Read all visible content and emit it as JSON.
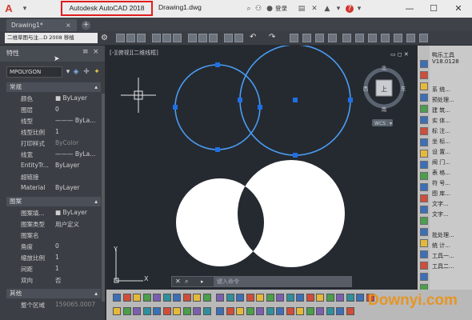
{
  "titlebar": {
    "app_logo": "A",
    "app_name": "Autodesk AutoCAD 2018",
    "document": "Drawing1.dwg",
    "login": "登录",
    "window_controls": [
      "—",
      "☐",
      "✕"
    ]
  },
  "tabs": {
    "active": "Drawing1*",
    "close_glyph": "×",
    "add_glyph": "+"
  },
  "toolbar": {
    "workspace": "二维草图与注...D 2008 移植"
  },
  "properties": {
    "title": "特性",
    "close_glyph": "×",
    "object_type": "MPOLYGON",
    "sections": [
      {
        "title": "常规",
        "rows": [
          {
            "label": "颜色",
            "value": "■ ByLayer"
          },
          {
            "label": "图层",
            "value": "0"
          },
          {
            "label": "线型",
            "value": "——— ByLa..."
          },
          {
            "label": "线型比例",
            "value": "1"
          },
          {
            "label": "打印样式",
            "value": "ByColor"
          },
          {
            "label": "线宽",
            "value": "——— ByLa..."
          },
          {
            "label": "EntityTr...",
            "value": "ByLayer"
          },
          {
            "label": "超链接",
            "value": ""
          },
          {
            "label": "Material",
            "value": "ByLayer"
          }
        ]
      },
      {
        "title": "图案",
        "rows": [
          {
            "label": "图案填...",
            "value": "■ ByLayer"
          },
          {
            "label": "图案类型",
            "value": "用户定义"
          },
          {
            "label": "图案名",
            "value": ""
          },
          {
            "label": "角度",
            "value": "0"
          },
          {
            "label": "缩放比例",
            "value": "1"
          },
          {
            "label": "间距",
            "value": "1"
          },
          {
            "label": "双向",
            "value": "否"
          }
        ]
      },
      {
        "title": "其他",
        "rows": [
          {
            "label": "整个区域",
            "value": "159065.0007"
          }
        ]
      }
    ]
  },
  "canvas": {
    "viewport_label": "[-][俯视][二维线框]",
    "viewcube": {
      "north": "北",
      "south": "南",
      "west": "西",
      "east": "东",
      "top": "上",
      "wcs": "WCS"
    },
    "ucs": {
      "x": "X",
      "y": "Y"
    },
    "command_placeholder": "键入命令",
    "accent": "#4a9cf2",
    "grip_color": "#1f6fe5"
  },
  "tool_panel": {
    "title": "鸭乐工具",
    "version": "V18.0128",
    "items": [
      "系 统...",
      "预处理...",
      "建 筑...",
      "实 体...",
      "标 注...",
      "坐 标...",
      "设 置...",
      "阀 门...",
      "表 格...",
      "符 号...",
      "图 库...",
      "文字...",
      "文字...",
      "",
      "批处理...",
      "统 计...",
      "工具一...",
      "工具二..."
    ]
  },
  "watermark": "Downyi.com"
}
